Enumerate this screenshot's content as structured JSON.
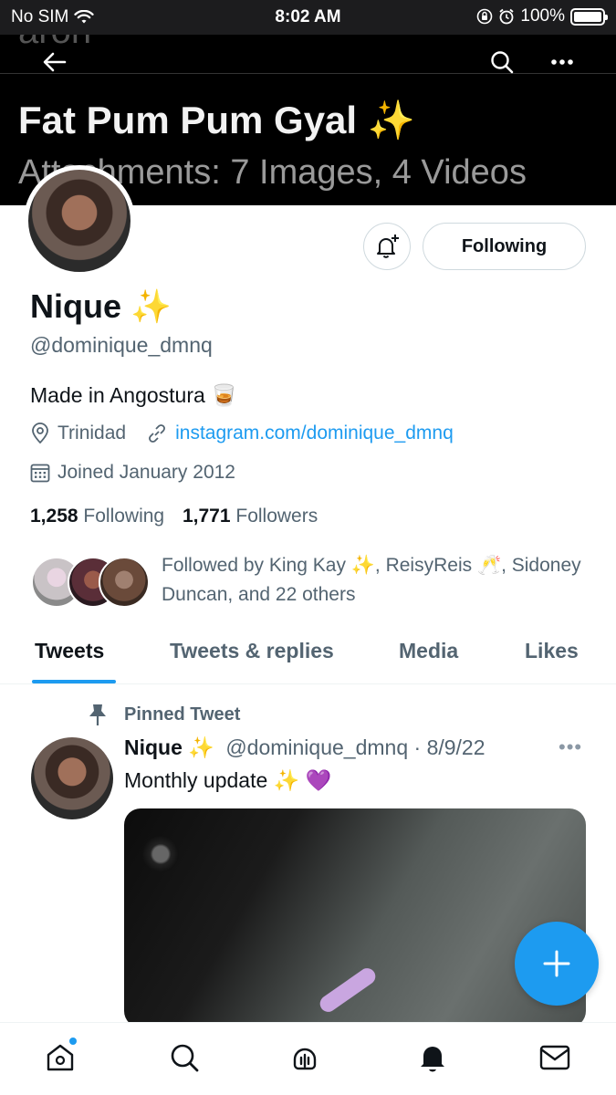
{
  "status_bar": {
    "carrier": "No SIM",
    "time": "8:02 AM",
    "battery": "100%",
    "battery_level": 1.0
  },
  "banner": {
    "ghost_text": "aron",
    "title": "Fat Pum Pum Gyal ✨",
    "subtitle": "Attachments: 7 Images, 4 Videos"
  },
  "profile": {
    "name": "Nique ✨",
    "handle": "@dominique_dmnq",
    "bio": "Made in Angostura 🥃",
    "location": "Trinidad",
    "website": "instagram.com/dominique_dmnq",
    "joined": "Joined January 2012",
    "following_count": "1,258",
    "following_label": "Following",
    "followers_count": "1,771",
    "followers_label": "Followers",
    "followed_by": "Followed by King Kay ✨, ReisyReis 🥂, Sidoney Duncan, and 22 others"
  },
  "actions": {
    "following_button": "Following"
  },
  "tabs": [
    {
      "label": "Tweets",
      "active": true
    },
    {
      "label": "Tweets & replies",
      "active": false
    },
    {
      "label": "Media",
      "active": false
    },
    {
      "label": "Likes",
      "active": false
    }
  ],
  "tweet": {
    "pinned_label": "Pinned Tweet",
    "author_name": "Nique ✨",
    "author_handle": "@dominique_dmnq",
    "date": "· 8/9/22",
    "text": "Monthly update ✨ 💜",
    "more": "•••"
  },
  "colors": {
    "accent": "#1d9bf0",
    "text": "#0f1419",
    "muted": "#536471"
  },
  "icons": {
    "nav": [
      "home-icon",
      "search-icon",
      "spaces-icon",
      "notifications-icon",
      "messages-icon"
    ]
  }
}
